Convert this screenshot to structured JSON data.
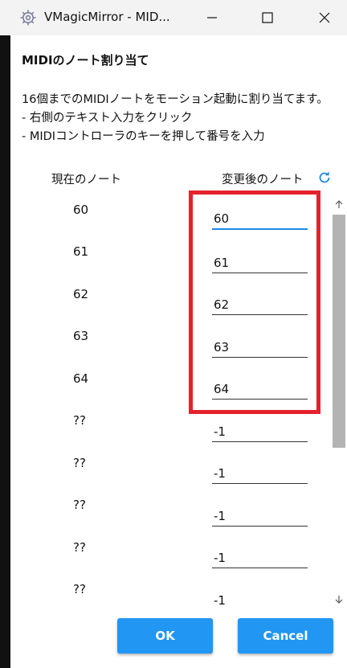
{
  "window": {
    "title": "VMagicMirror - MID...",
    "app_icon": "gear-cog-icon",
    "controls": [
      "minimize-icon",
      "maximize-icon",
      "close-icon"
    ]
  },
  "dialog": {
    "heading": "MIDIのノート割り当て",
    "description": [
      "16個までのMIDIノートをモーション起動に割り当てます。",
      "- 右側のテキスト入力をクリック",
      "- MIDIコントローラのキーを押して番号を入力"
    ],
    "current_header": "現在のノート",
    "new_header": "変更後のノート",
    "refresh_icon": "refresh-icon",
    "rows": [
      {
        "current": "60",
        "new": "60"
      },
      {
        "current": "61",
        "new": "61"
      },
      {
        "current": "62",
        "new": "62"
      },
      {
        "current": "63",
        "new": "63"
      },
      {
        "current": "64",
        "new": "64"
      },
      {
        "current": "??",
        "new": "-1"
      },
      {
        "current": "??",
        "new": "-1"
      },
      {
        "current": "??",
        "new": "-1"
      },
      {
        "current": "??",
        "new": "-1"
      },
      {
        "current": "??",
        "new": "-1"
      }
    ],
    "ok_label": "OK",
    "cancel_label": "Cancel"
  },
  "colors": {
    "accent": "#2196f3",
    "focus_underline": "#1e88e5",
    "highlight": "#e5212c"
  }
}
